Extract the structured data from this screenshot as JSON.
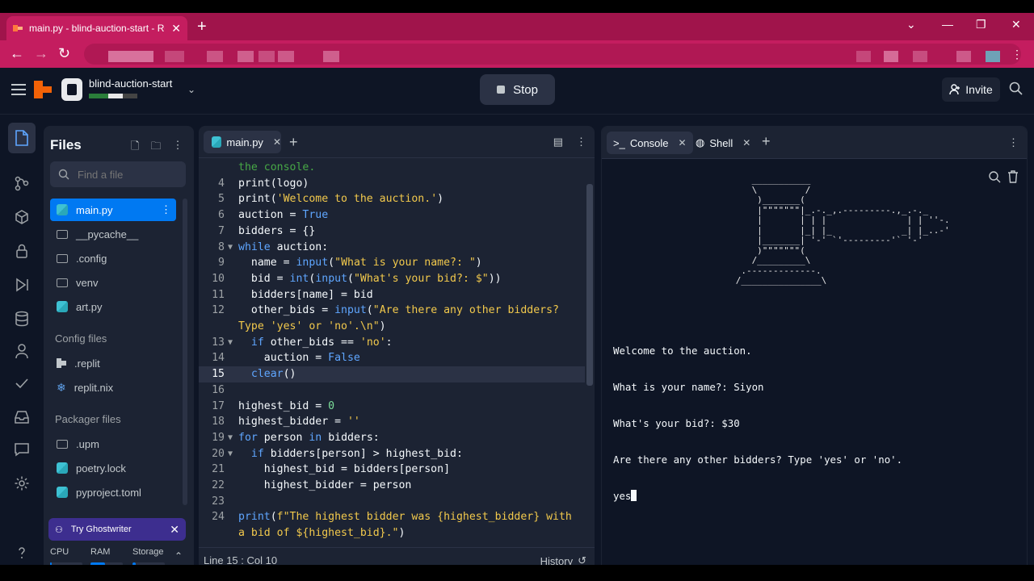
{
  "browser": {
    "tab_title": "main.py - blind-auction-start - Re",
    "tab_close": "✕",
    "new_tab": "+"
  },
  "header": {
    "repl_name": "blind-auction-start",
    "stop_label": "Stop",
    "invite_label": "Invite"
  },
  "files": {
    "title": "Files",
    "search_placeholder": "Find a file",
    "items": [
      {
        "label": "main.py",
        "icon": "python-icon",
        "selected": true
      },
      {
        "label": "__pycache__",
        "icon": "folder-icon"
      },
      {
        "label": ".config",
        "icon": "folder-icon"
      },
      {
        "label": "venv",
        "icon": "folder-icon"
      },
      {
        "label": "art.py",
        "icon": "python-icon"
      }
    ],
    "config_header": "Config files",
    "config_items": [
      {
        "label": ".replit",
        "icon": "replit-icon"
      },
      {
        "label": "replit.nix",
        "icon": "nix-icon"
      }
    ],
    "packager_header": "Packager files",
    "packager_items": [
      {
        "label": ".upm",
        "icon": "folder-icon"
      },
      {
        "label": "poetry.lock",
        "icon": "python-icon"
      },
      {
        "label": "pyproject.toml",
        "icon": "python-icon"
      }
    ],
    "ghostwriter": "Try Ghostwriter",
    "resources": {
      "cpu": "CPU",
      "ram": "RAM",
      "storage": "Storage",
      "cpu_usage": 0.05,
      "ram_usage": 0.45,
      "storage_usage": 0.1
    }
  },
  "editor": {
    "tab_label": "main.py",
    "status": "Line 15 : Col 10",
    "history_label": "History",
    "lines": [
      {
        "n": "",
        "html": "<span class=\"cm\">the console.</span>"
      },
      {
        "n": "4",
        "html": "print(logo)"
      },
      {
        "n": "5",
        "html": "print(<span class=\"st\">'Welcome to the auction.'</span>)"
      },
      {
        "n": "6",
        "html": "auction = <span class=\"kw\">True</span>"
      },
      {
        "n": "7",
        "html": "bidders = {}"
      },
      {
        "n": "8",
        "fold": true,
        "html": "<span class=\"kw\">while</span> auction:"
      },
      {
        "n": "9",
        "html": "  name = <span class=\"kw\">input</span>(<span class=\"st\">\"What is your name?: \"</span>)"
      },
      {
        "n": "10",
        "html": "  bid = <span class=\"kw\">int</span>(<span class=\"kw\">input</span>(<span class=\"st\">\"What's your bid?: $\"</span>))"
      },
      {
        "n": "11",
        "html": "  bidders[name] = bid"
      },
      {
        "n": "12",
        "html": "  other_bids = <span class=\"kw\">input</span>(<span class=\"st\">\"Are there any other bidders?</span>"
      },
      {
        "n": "",
        "html": "<span class=\"st\">Type 'yes' or 'no'.\\n\"</span>)"
      },
      {
        "n": "13",
        "fold": true,
        "html": "  <span class=\"kw\">if</span> other_bids == <span class=\"st\">'no'</span>:"
      },
      {
        "n": "14",
        "html": "    auction = <span class=\"kw\">False</span>"
      },
      {
        "n": "15",
        "cur": true,
        "html": "  <span class=\"kw\">clear</span>()"
      },
      {
        "n": "16",
        "html": ""
      },
      {
        "n": "17",
        "html": "highest_bid = <span class=\"nu\">0</span>"
      },
      {
        "n": "18",
        "html": "highest_bidder = <span class=\"st\">''</span>"
      },
      {
        "n": "19",
        "fold": true,
        "html": "<span class=\"kw\">for</span> person <span class=\"kw\">in</span> bidders:"
      },
      {
        "n": "20",
        "fold": true,
        "html": "  <span class=\"kw\">if</span> bidders[person] &gt; highest_bid:"
      },
      {
        "n": "21",
        "html": "    highest_bid = bidders[person]"
      },
      {
        "n": "22",
        "html": "    highest_bidder = person"
      },
      {
        "n": "23",
        "html": ""
      },
      {
        "n": "24",
        "html": "<span class=\"kw\">print</span>(<span class=\"st\">f\"The highest bidder was {highest_bidder} with</span>"
      },
      {
        "n": "",
        "html": "<span class=\"st\">a bid of ${highest_bid}.\"</span>)"
      }
    ]
  },
  "console": {
    "tab_console": "Console",
    "tab_shell": "Shell",
    "ascii_art": "                         ___________\n                         \\         /\n                          )_______(\n                          |\"\"\"\"\"\"\"|_.-._,.---------.,_.-._\n                          |       | | |               | | ''-.\n                          |       |_| |_             _| |_..-'\n                          |_______| '-' `'---------'` '-'\n                          )\"\"\"\"\"\"\"(\n                         /_________\\\n                       .-------------.\n                      /_______________\\",
    "output_lines": [
      "Welcome to the auction.",
      "What is your name?: Siyon",
      "What's your bid?: $30",
      "Are there any other bidders? Type 'yes' or 'no'."
    ],
    "input_line": "yes"
  }
}
